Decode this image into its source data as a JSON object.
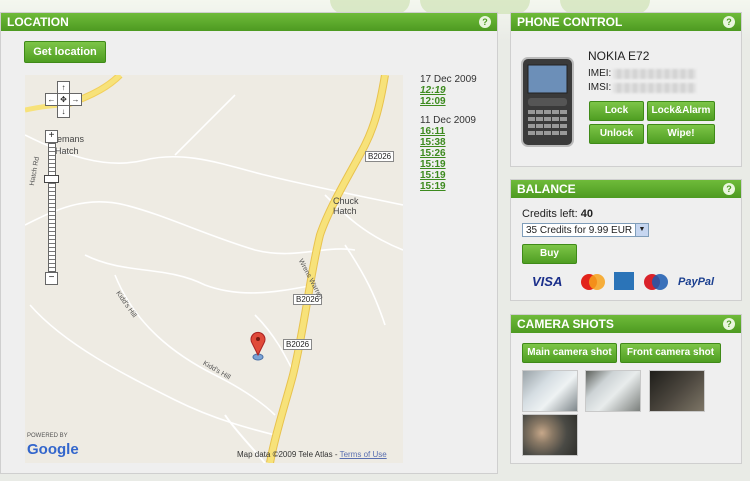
{
  "location": {
    "title": "LOCATION",
    "help": "?",
    "get_location_label": "Get location",
    "history": [
      {
        "date": "17 Dec 2009",
        "times": [
          "12:19",
          "12:09"
        ]
      },
      {
        "date": "11 Dec 2009",
        "times": [
          "16:11",
          "15:38",
          "15:26",
          "15:19",
          "15:19",
          "15:19"
        ]
      }
    ],
    "map": {
      "labels": {
        "b2026_a": "B2026",
        "b2026_b": "B2026",
        "b2026_c": "B2026",
        "chuck_hatch_1": "Chuck",
        "chuck_hatch_2": "Hatch",
        "mans_1": "lemans",
        "mans_2": "Hatch",
        "kidds_hill_1": "Kidd's Hill",
        "kidds_hill_2": "Kidd's Hill",
        "wrens_warren": "Wrens Warren",
        "hatch_rd": "Hatch Rd",
        "powered_by": "POWERED BY",
        "google": "Google",
        "map_data": "Map data ©2009 Tele Atlas -",
        "terms": "Terms of Use"
      }
    }
  },
  "phone": {
    "title": "PHONE CONTROL",
    "help": "?",
    "model": "NOKIA E72",
    "imei_label": "IMEI:",
    "imsi_label": "IMSI:",
    "buttons": {
      "lock": "Lock",
      "lock_alarm": "Lock&Alarm",
      "unlock": "Unlock",
      "wipe": "Wipe!"
    }
  },
  "balance": {
    "title": "BALANCE",
    "help": "?",
    "credits_label": "Credits left:",
    "credits_value": "40",
    "selected_package": "35 Credits for 9.99 EUR",
    "buy_label": "Buy",
    "payment_methods": [
      "VISA",
      "MasterCard",
      "AmEx",
      "Maestro",
      "PayPal"
    ]
  },
  "camera": {
    "title": "CAMERA SHOTS",
    "help": "?",
    "main_label": "Main camera shot",
    "front_label": "Front camera shot"
  },
  "colors": {
    "accent": "#4d9a21",
    "accent_light": "#7dc548",
    "road": "#f7e27a"
  }
}
